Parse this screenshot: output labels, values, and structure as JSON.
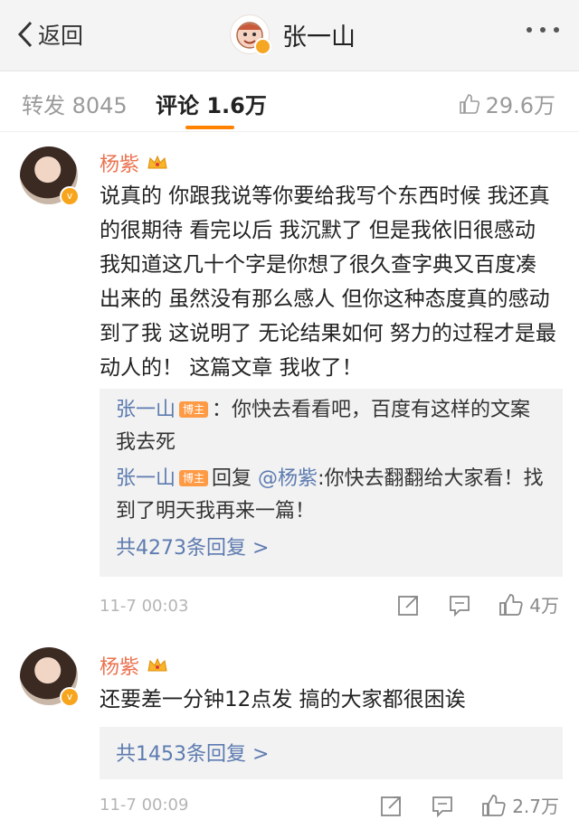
{
  "nav": {
    "back_label": "返回",
    "title": "张一山"
  },
  "tabs": {
    "forward": "转发 8045",
    "comment": "评论 1.6万",
    "like": "29.6万"
  },
  "comments": [
    {
      "author": "杨紫",
      "text": "说真的 你跟我说等你要给我写个东西时候 我还真的很期待 看完以后 我沉默了 但是我依旧很感动 我知道这几十个字是你想了很久查字典又百度凑出来的 虽然没有那么感人 但你这种态度真的感动到了我 这说明了 无论结果如何 努力的过程才是最动人的！ 这篇文章 我收了！",
      "replies": [
        {
          "name": "张一山",
          "badge": "博主",
          "text": "：你快去看看吧，百度有这样的文案我去死"
        },
        {
          "name": "张一山",
          "badge": "博主",
          "prefix": "回复",
          "mention": "@杨紫",
          "text": ":你快去翻翻给大家看！找到了明天我再来一篇！"
        }
      ],
      "more_replies": "共4273条回复 >",
      "time": "11-7 00:03",
      "likes": "4万"
    },
    {
      "author": "杨紫",
      "text": "还要差一分钟12点发 搞的大家都很困诶",
      "more_replies": "共1453条回复 >",
      "time": "11-7 00:09",
      "likes": "2.7万"
    }
  ],
  "icons": {
    "back": "chevron-left-icon",
    "more": "more-dots-icon",
    "forward": "share-icon",
    "comment": "comment-icon",
    "like": "thumbs-up-icon",
    "crown": "crown-icon",
    "verified": "verified-badge-icon"
  },
  "colors": {
    "accent": "#ff8200",
    "author": "#eb7350",
    "link": "#5d7bb0",
    "badge": "#ff9a45"
  }
}
